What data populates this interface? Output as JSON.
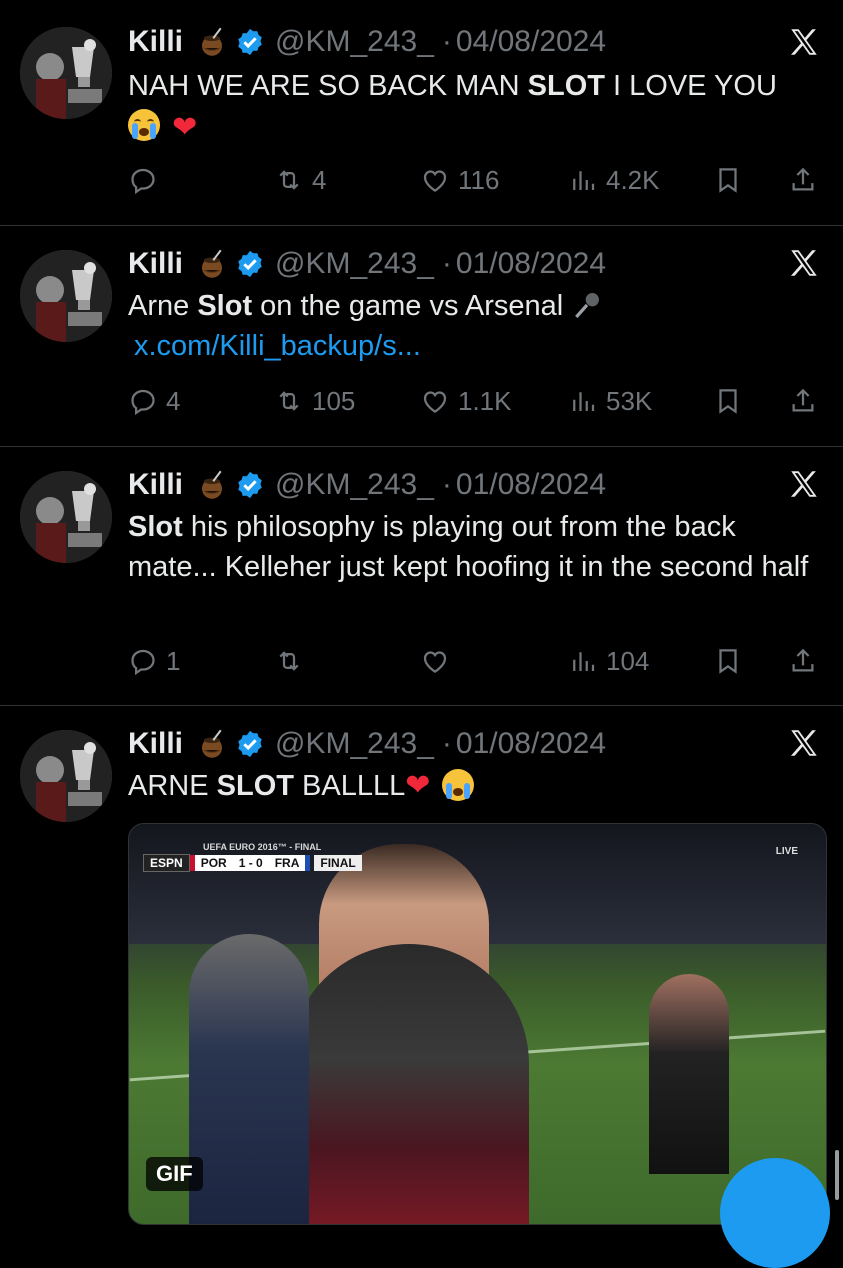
{
  "tweets": [
    {
      "name": "Killi",
      "handle": "@KM_243_",
      "sep": "·",
      "date": "04/08/2024",
      "text_parts": [
        "NAH WE ARE SO BACK MAN ",
        "SLOT",
        " I LOVE YOU"
      ],
      "reply_count": "",
      "retweet_count": "4",
      "like_count": "116",
      "view_count": "4.2K"
    },
    {
      "name": "Killi",
      "handle": "@KM_243_",
      "sep": "·",
      "date": "01/08/2024",
      "text_parts": [
        "Arne ",
        "Slot",
        " on the game vs Arsenal "
      ],
      "link": "x.com/Killi_backup/s...",
      "reply_count": "4",
      "retweet_count": "105",
      "like_count": "1.1K",
      "view_count": "53K"
    },
    {
      "name": "Killi",
      "handle": "@KM_243_",
      "sep": "·",
      "date": "01/08/2024",
      "text_parts": [
        "Slot",
        " his philosophy is playing out from the back mate... Kelleher just kept hoofing it in the second half"
      ],
      "reply_count": "1",
      "retweet_count": "",
      "like_count": "",
      "view_count": "104"
    },
    {
      "name": "Killi",
      "handle": "@KM_243_",
      "sep": "·",
      "date": "01/08/2024",
      "text_parts": [
        "ARNE ",
        "SLOT",
        " BALLLL"
      ],
      "media": {
        "badge": "GIF",
        "scoreboard_title": "UEFA EURO 2016™ - FINAL",
        "broadcaster": "ESPN",
        "team_home": "POR",
        "score": "1 - 0",
        "team_away": "FRA",
        "status": "FINAL",
        "live": "LIVE"
      }
    }
  ],
  "icons": {
    "reply": "reply-icon",
    "retweet": "retweet-icon",
    "like": "heart-icon",
    "views": "views-icon",
    "bookmark": "bookmark-icon",
    "share": "share-icon",
    "platform": "x-logo-icon",
    "verified": "verified-badge-icon"
  },
  "colors": {
    "background": "#000000",
    "text": "#e7e9ea",
    "muted": "#71767b",
    "accent": "#1d9bf0",
    "divider": "#2f3336"
  }
}
